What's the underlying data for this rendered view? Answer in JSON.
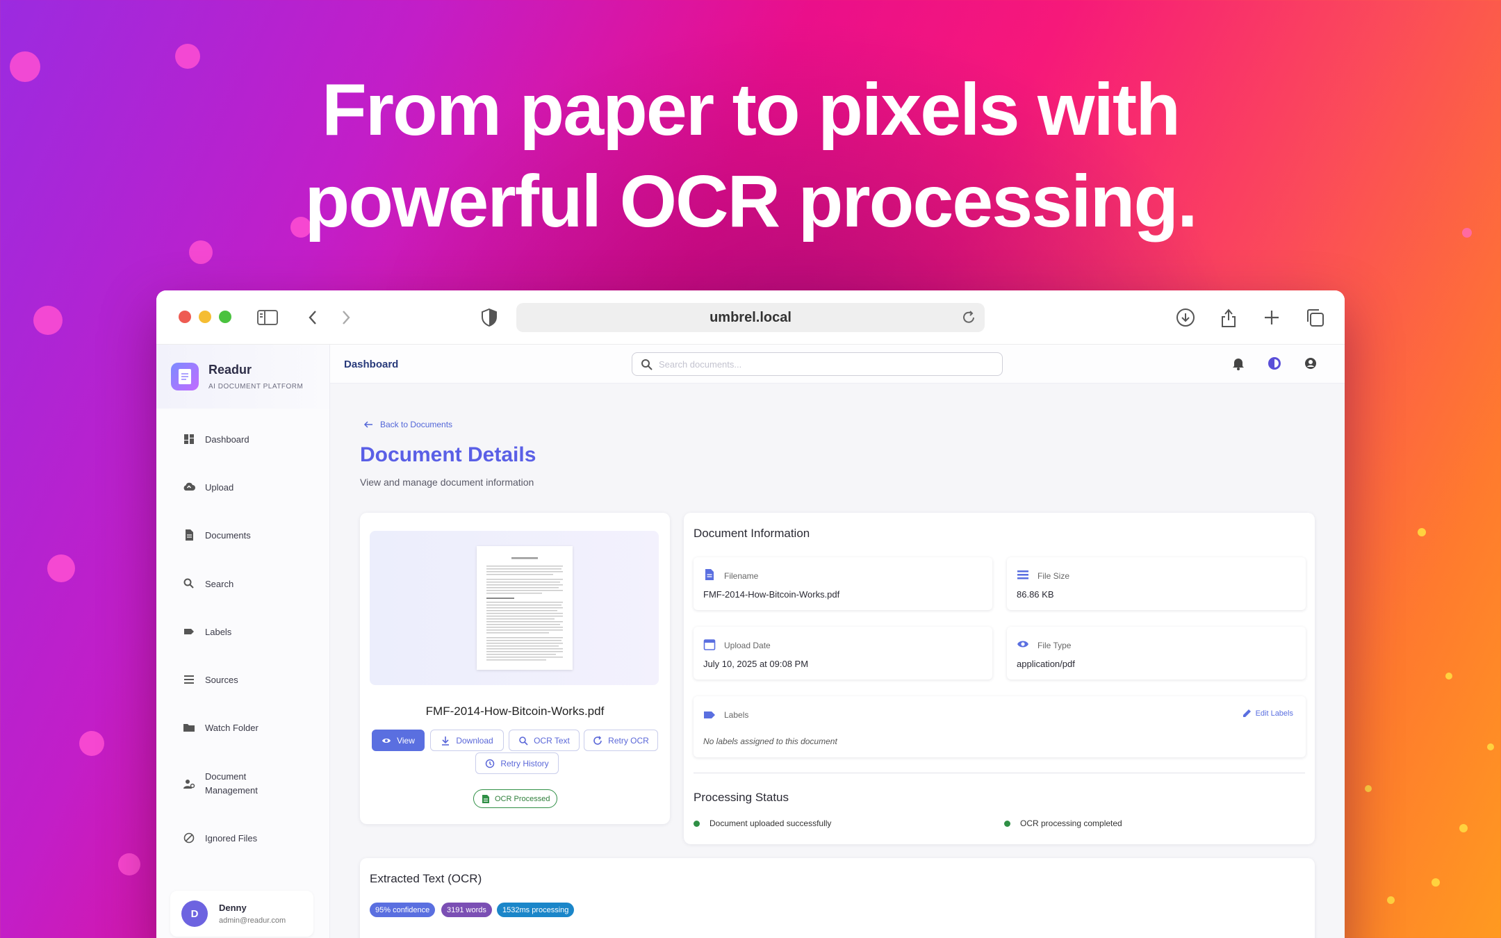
{
  "hero": {
    "line1": "From paper to pixels with",
    "line2": "powerful OCR processing."
  },
  "browser": {
    "url": "umbrel.local",
    "icons": [
      "sidebar-icon",
      "back-arrow-icon",
      "forward-arrow-icon",
      "shield-icon",
      "reload-icon",
      "download-icon",
      "share-icon",
      "plus-icon",
      "tabs-icon"
    ]
  },
  "brand": {
    "name": "Readur",
    "tagline": "AI DOCUMENT PLATFORM"
  },
  "sidebar": {
    "items": [
      {
        "label": "Dashboard",
        "icon": "dashboard-icon"
      },
      {
        "label": "Upload",
        "icon": "cloud-upload-icon"
      },
      {
        "label": "Documents",
        "icon": "document-icon"
      },
      {
        "label": "Search",
        "icon": "search-icon"
      },
      {
        "label": "Labels",
        "icon": "label-icon"
      },
      {
        "label": "Sources",
        "icon": "list-icon"
      },
      {
        "label": "Watch Folder",
        "icon": "folder-icon"
      },
      {
        "label": "Document Management",
        "icon": "manage-icon"
      },
      {
        "label": "Ignored Files",
        "icon": "block-icon"
      }
    ],
    "user": {
      "initial": "D",
      "name": "Denny",
      "email": "admin@readur.com"
    }
  },
  "topbar": {
    "breadcrumb": "Dashboard",
    "search_placeholder": "Search documents..."
  },
  "page": {
    "back_link": "Back to Documents",
    "title": "Document Details",
    "subtitle": "View and manage document information"
  },
  "document": {
    "filename": "FMF-2014-How-Bitcoin-Works.pdf",
    "buttons": {
      "view": "View",
      "download": "Download",
      "ocr_text": "OCR Text",
      "retry_ocr": "Retry OCR",
      "retry_history": "Retry History"
    },
    "status_chip": "OCR Processed"
  },
  "info": {
    "title": "Document Information",
    "fields": {
      "filename_label": "Filename",
      "filename_value": "FMF-2014-How-Bitcoin-Works.pdf",
      "size_label": "File Size",
      "size_value": "86.86 KB",
      "date_label": "Upload Date",
      "date_value": "July 10, 2025 at 09:08 PM",
      "type_label": "File Type",
      "type_value": "application/pdf"
    },
    "labels": {
      "label": "Labels",
      "edit": "Edit Labels",
      "empty": "No labels assigned to this document"
    },
    "processing": {
      "title": "Processing Status",
      "steps": [
        "Document uploaded successfully",
        "OCR processing completed"
      ]
    }
  },
  "extracted": {
    "title": "Extracted Text (OCR)",
    "badges": {
      "confidence": "95% confidence",
      "words": "3191 words",
      "time": "1532ms processing"
    }
  },
  "colors": {
    "accent": "#5a6fe0",
    "success": "#2f8f45",
    "confidence_badge": "#5a6fe0",
    "words_badge": "#7b4fb4",
    "time_badge": "#1b86c9"
  }
}
